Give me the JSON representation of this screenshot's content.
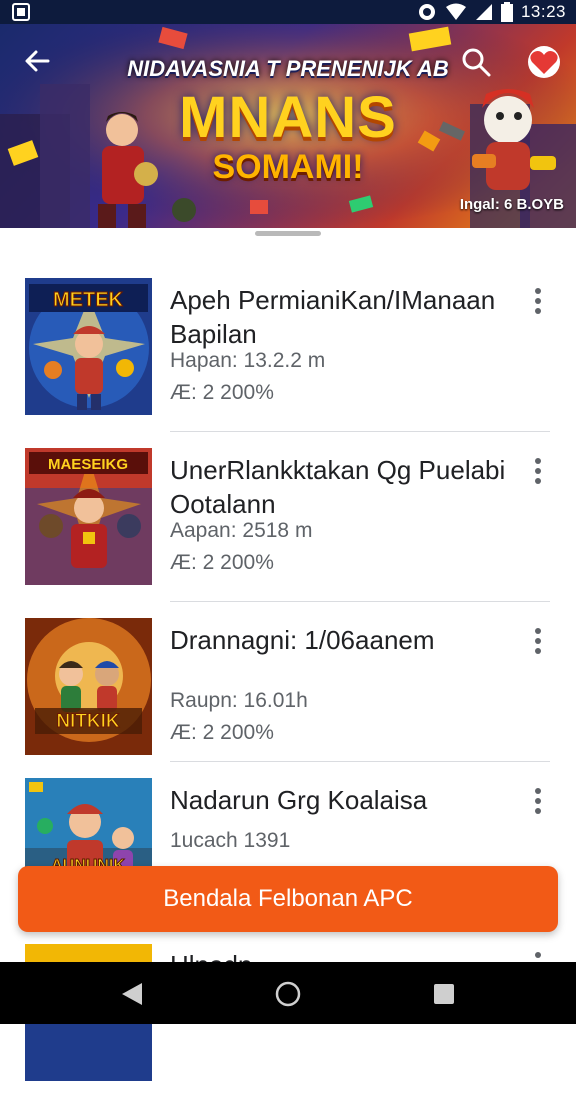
{
  "status_bar": {
    "time": "13:23",
    "icons": [
      "notification-icon",
      "sync-icon",
      "wifi-icon",
      "signal-icon",
      "battery-icon"
    ]
  },
  "banner": {
    "subtitle": "NIDAVASNIA T PRENENIJK AB",
    "title_main": "MNANS",
    "title_sub": "SOMAMI!",
    "tag": "Ingal: 6 B.OYB",
    "icons": [
      "back-arrow-icon",
      "search-icon",
      "heart-badge-icon"
    ]
  },
  "items": [
    {
      "name": "Apeh PermianiKan/IManaan Bapilan",
      "meta1": "Hapan: 13.2.2 m",
      "meta2": "Æ: 2 200%",
      "thumb_title": "METEK",
      "thumb_colors": [
        "#1f3c8c",
        "#f2b705",
        "#c0392b"
      ]
    },
    {
      "name": "UnerRlankktakan Qg Puelabi Ootalann",
      "meta1": "Aapan:  2518 m",
      "meta2": "Æ: 2 200%",
      "thumb_title": "MAESEIKG",
      "thumb_colors": [
        "#c0392b",
        "#2c3e8c",
        "#f39c12"
      ]
    },
    {
      "name": "Drannagni: 1/06aanem",
      "meta1": "Raupn:  16.01h",
      "meta2": "Æ: 2 200%",
      "thumb_title": "NITKIK",
      "thumb_colors": [
        "#e67e22",
        "#2d7d3a",
        "#f1c40f"
      ]
    },
    {
      "name": "Nadarun Grg Koalaisa",
      "meta1": "1ucach 1391",
      "meta2": "",
      "thumb_title": "AUNUNIK",
      "thumb_colors": [
        "#2980b9",
        "#c0392b",
        "#27ae60"
      ]
    },
    {
      "name": "Hlnedn...",
      "meta1": "",
      "meta2": "",
      "thumb_title": "",
      "thumb_colors": [
        "#1f3c8c",
        "#f2b705",
        "#c0392b"
      ]
    }
  ],
  "download_button": {
    "label": "Bendala Felbonan APC",
    "color": "#f25a16"
  },
  "navbar": {
    "icons": [
      "back-triangle-icon",
      "home-circle-icon",
      "recents-square-icon"
    ]
  }
}
